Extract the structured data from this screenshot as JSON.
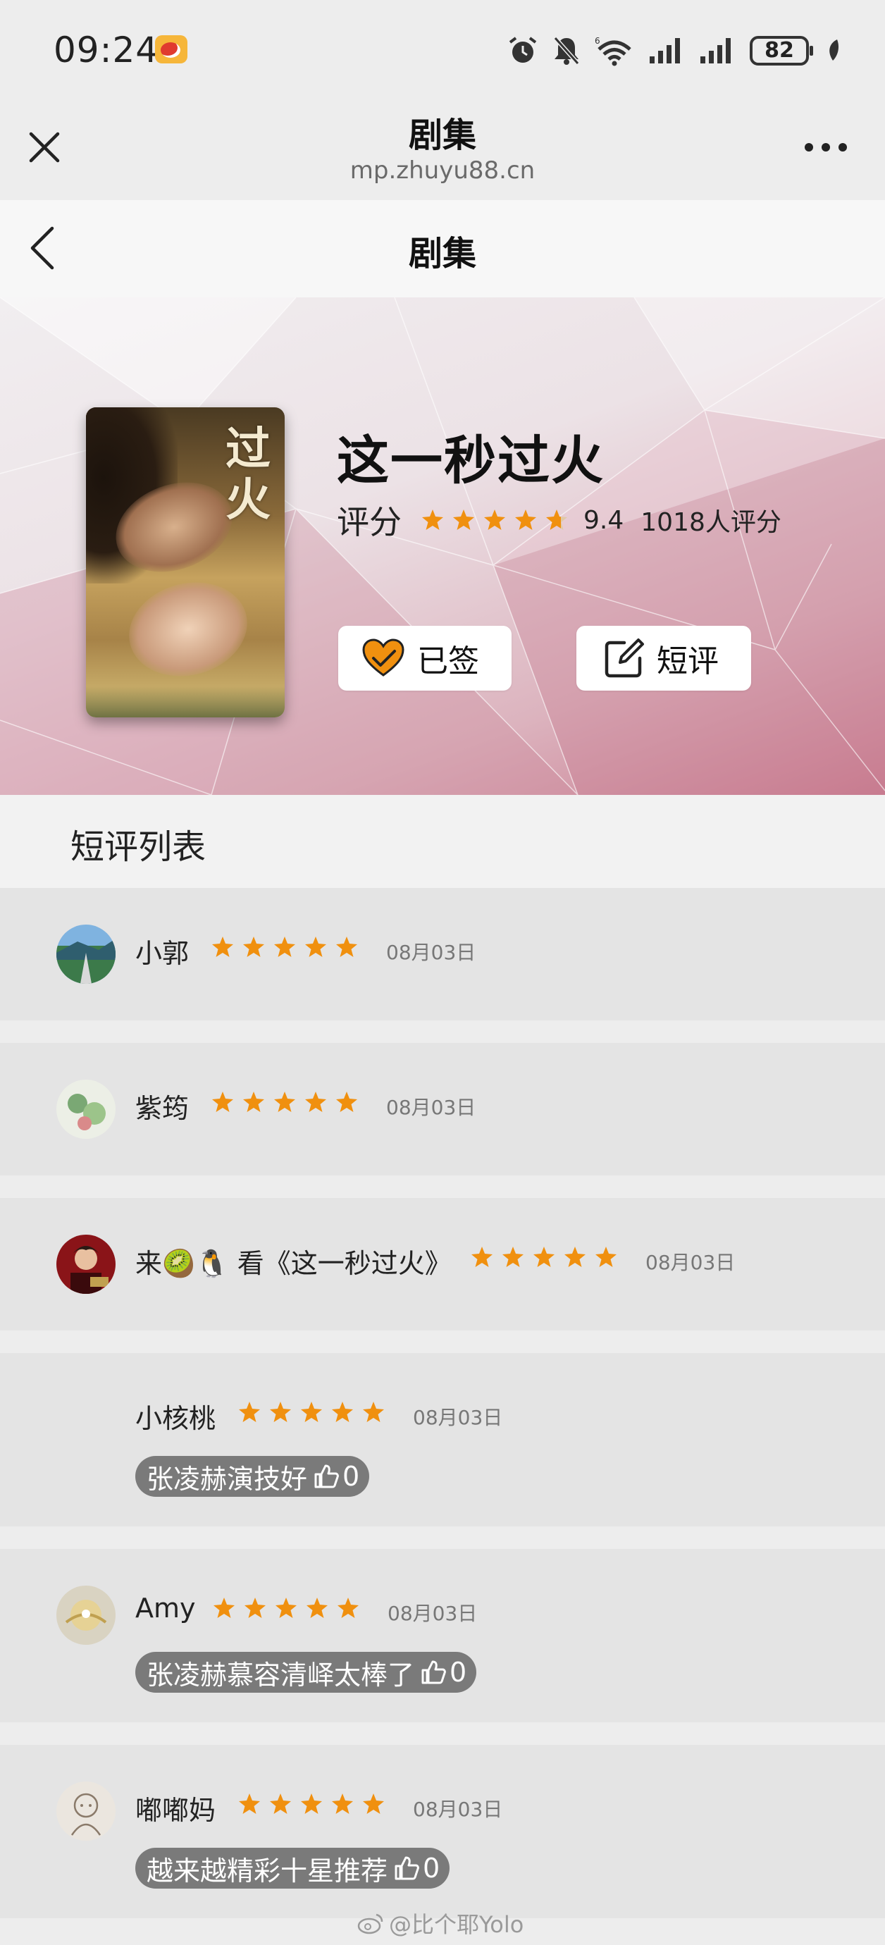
{
  "status_bar": {
    "time": "09:24",
    "battery": "82",
    "icons": [
      "weibo-icon",
      "alarm-icon",
      "mute-icon",
      "wifi-6-icon",
      "signal-icon",
      "signal-icon",
      "battery-icon",
      "leaf-icon"
    ]
  },
  "title_bar": {
    "title": "剧集",
    "domain": "mp.zhuyu88.cn"
  },
  "page_nav": {
    "title": "剧集"
  },
  "show": {
    "title": "这一秒过火",
    "poster_title": "过火",
    "rating_label": "评分",
    "score": "9.4",
    "rating_count": "1018人评分",
    "stars": 4.7,
    "signed_label": "已签",
    "review_label": "短评"
  },
  "section": {
    "title": "短评列表"
  },
  "reviews": [
    {
      "name": "小郭",
      "stars": 5,
      "date": "08月03日",
      "comment": "",
      "likes": ""
    },
    {
      "name": "紫筠",
      "stars": 5,
      "date": "08月03日",
      "comment": "",
      "likes": ""
    },
    {
      "name": "来🥝🐧 看《这一秒过火》",
      "stars": 5,
      "date": "08月03日",
      "comment": "",
      "likes": ""
    },
    {
      "name": "小核桃",
      "stars": 5,
      "date": "08月03日",
      "comment": "张凌赫演技好",
      "likes": "0"
    },
    {
      "name": "Amy",
      "stars": 5,
      "date": "08月03日",
      "comment": "张凌赫慕容清峄太棒了",
      "likes": "0"
    },
    {
      "name": "嘟嘟妈",
      "stars": 5,
      "date": "08月03日",
      "comment": "越来越精彩十星推荐",
      "likes": "0"
    }
  ],
  "watermark": "@比个耶Yolo",
  "colors": {
    "star": "#f0900f",
    "tag_bg": "#7a7a7a",
    "heart": "#f0900f"
  }
}
